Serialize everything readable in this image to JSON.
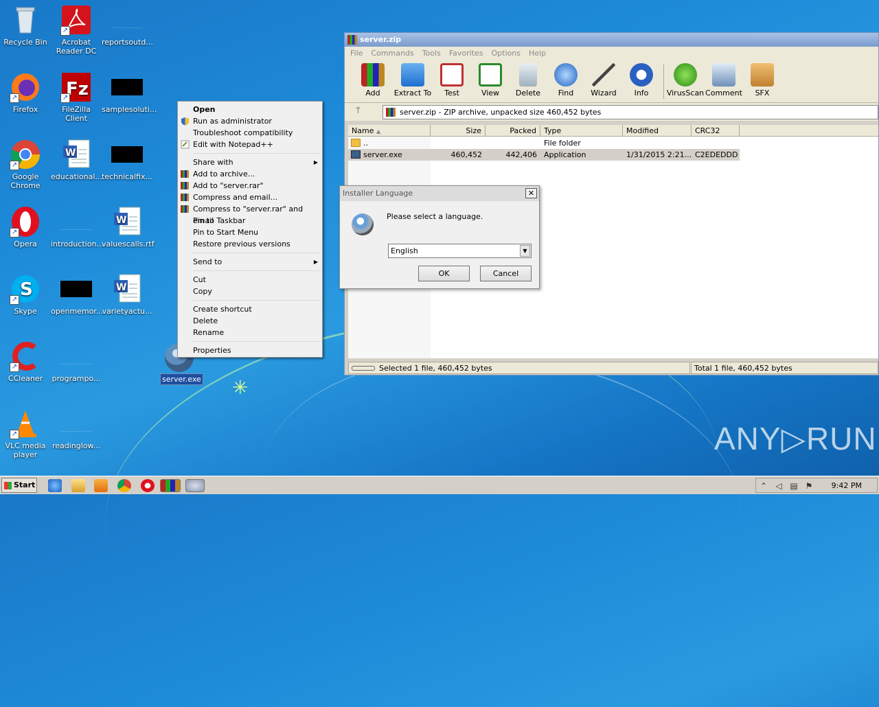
{
  "desktop": {
    "icons": [
      {
        "label": "Recycle Bin"
      },
      {
        "label": "Acrobat Reader DC"
      },
      {
        "label": "reportsoutd..."
      },
      {
        "label": "Firefox"
      },
      {
        "label": "FileZilla Client"
      },
      {
        "label": "samplesoluti..."
      },
      {
        "label": "Google Chrome"
      },
      {
        "label": "educational..."
      },
      {
        "label": "technicalfix..."
      },
      {
        "label": "Opera"
      },
      {
        "label": "introduction..."
      },
      {
        "label": "valuescalls.rtf"
      },
      {
        "label": "Skype"
      },
      {
        "label": "openmemor..."
      },
      {
        "label": "varietyactu..."
      },
      {
        "label": "CCleaner"
      },
      {
        "label": "programpo..."
      },
      {
        "label": "VLC media player"
      },
      {
        "label": "readinglow..."
      },
      {
        "label": "server.exe"
      }
    ],
    "watermark": "ANY▷RUN"
  },
  "context_menu": {
    "items": [
      "Open",
      "Run as administrator",
      "Troubleshoot compatibility",
      "Edit with Notepad++",
      "Share with",
      "Add to archive...",
      "Add to \"server.rar\"",
      "Compress and email...",
      "Compress to \"server.rar\" and email",
      "Pin to Taskbar",
      "Pin to Start Menu",
      "Restore previous versions",
      "Send to",
      "Cut",
      "Copy",
      "Create shortcut",
      "Delete",
      "Rename",
      "Properties"
    ]
  },
  "winrar": {
    "title": "server.zip",
    "menu": [
      "File",
      "Commands",
      "Tools",
      "Favorites",
      "Options",
      "Help"
    ],
    "toolbar": [
      "Add",
      "Extract To",
      "Test",
      "View",
      "Delete",
      "Find",
      "Wizard",
      "Info",
      "VirusScan",
      "Comment",
      "SFX"
    ],
    "address": "server.zip - ZIP archive, unpacked size 460,452 bytes",
    "columns": [
      "Name",
      "Size",
      "Packed",
      "Type",
      "Modified",
      "CRC32"
    ],
    "rows": [
      {
        "name": "..",
        "size": "",
        "packed": "",
        "type": "File folder",
        "modified": "",
        "crc": ""
      },
      {
        "name": "server.exe",
        "size": "460,452",
        "packed": "442,406",
        "type": "Application",
        "modified": "1/31/2015 2:21...",
        "crc": "C2EDEDDD"
      }
    ],
    "status_left": "Selected 1 file, 460,452 bytes",
    "status_right": "Total 1 file, 460,452 bytes"
  },
  "dialog": {
    "title": "Installer Language",
    "close": "✕",
    "message": "Please select a language.",
    "selected_language": "English",
    "ok": "OK",
    "cancel": "Cancel"
  },
  "taskbar": {
    "start": "Start",
    "clock": "9:42 PM"
  }
}
